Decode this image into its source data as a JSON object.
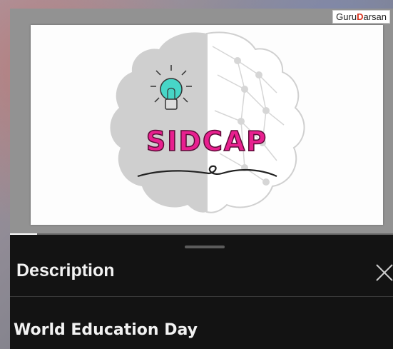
{
  "video": {
    "watermark": {
      "prefix": "Guru",
      "accent": "D",
      "suffix": "arsan"
    },
    "slide_logo_text": "SIDCAP",
    "progress_fraction": 0.07
  },
  "sheet": {
    "title": "Description",
    "event_title": "World Education Day"
  },
  "colors": {
    "sheet_background": "#131313",
    "logo_text": "#e8208f",
    "brain_left": "#cfcfcf",
    "bulb": "#47d6c7"
  },
  "icons": [
    "lightbulb-icon",
    "close-icon"
  ]
}
